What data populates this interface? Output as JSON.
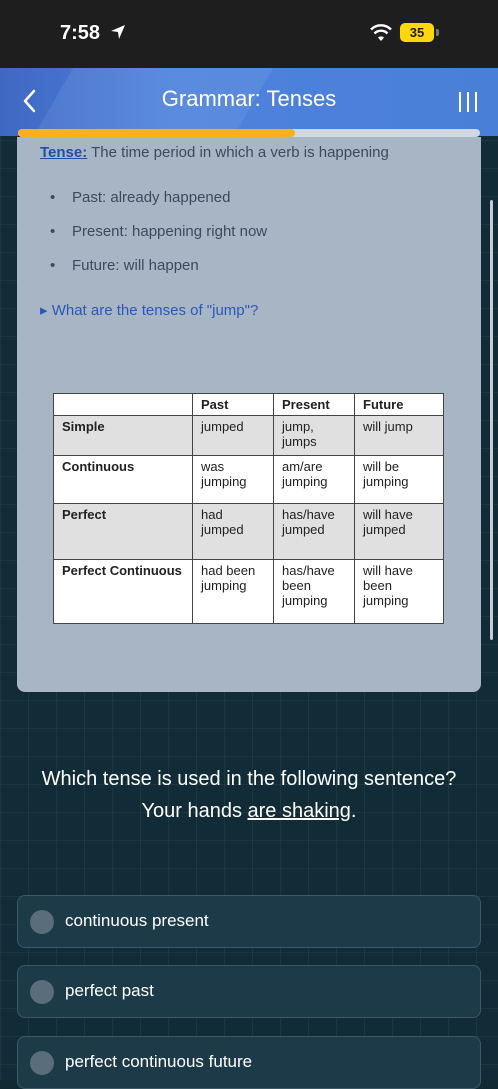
{
  "status": {
    "time": "7:58",
    "battery": "35"
  },
  "header": {
    "title": "Grammar: Tenses"
  },
  "progress": {
    "fraction": 0.6
  },
  "lesson": {
    "term": "Tense:",
    "definition": " The time period in which a verb is happening",
    "bullets": [
      "Past: already happened",
      "Present: happening right now",
      "Future: will happen"
    ],
    "disclosure": "What are the tenses of \"jump\"?"
  },
  "table": {
    "headers": [
      "",
      "Past",
      "Present",
      "Future"
    ],
    "rows": [
      {
        "label": "Simple",
        "past": "jumped",
        "present": "jump, jumps",
        "future": "will jump"
      },
      {
        "label": "Continuous",
        "past": "was jumping",
        "present": "am/are jumping",
        "future": "will be jumping"
      },
      {
        "label": "Perfect",
        "past": "had jumped",
        "present": "has/have jumped",
        "future": "will have jumped"
      },
      {
        "label": "Perfect Continuous",
        "past": "had been jumping",
        "present": "has/have been jumping",
        "future": "will have been jumping"
      }
    ]
  },
  "question": {
    "prompt": "Which tense is used in the following sentence?",
    "sentence_start": "Your hands ",
    "sentence_underlined": "are shaking",
    "sentence_end": "."
  },
  "options": [
    "continuous present",
    "perfect past",
    "perfect continuous future"
  ]
}
